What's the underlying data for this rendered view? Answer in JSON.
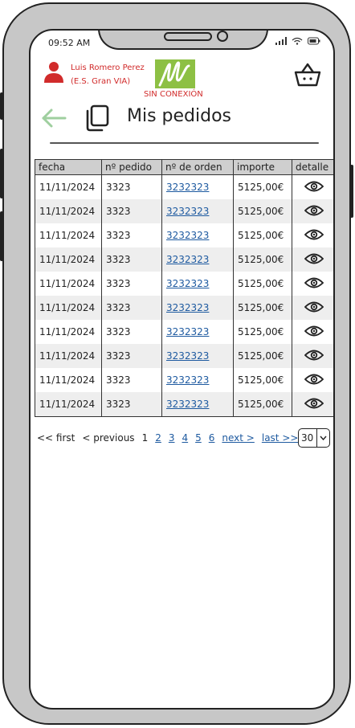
{
  "status": {
    "time": "09:52 AM"
  },
  "user": {
    "name": "Luis Romero Perez",
    "station": "(E.S. Gran VIA)"
  },
  "logo": {
    "letter": "M"
  },
  "connection": {
    "status": "SIN CONEXIÓN"
  },
  "page": {
    "title": "Mis pedidos"
  },
  "table": {
    "headers": [
      "fecha",
      "nº pedido",
      "nº de orden",
      "importe",
      "detalle"
    ],
    "rows": [
      {
        "fecha": "11/11/2024",
        "pedido": "3323",
        "orden": "3232323",
        "importe": "5125,00€"
      },
      {
        "fecha": "11/11/2024",
        "pedido": "3323",
        "orden": "3232323",
        "importe": "5125,00€"
      },
      {
        "fecha": "11/11/2024",
        "pedido": "3323",
        "orden": "3232323",
        "importe": "5125,00€"
      },
      {
        "fecha": "11/11/2024",
        "pedido": "3323",
        "orden": "3232323",
        "importe": "5125,00€"
      },
      {
        "fecha": "11/11/2024",
        "pedido": "3323",
        "orden": "3232323",
        "importe": "5125,00€"
      },
      {
        "fecha": "11/11/2024",
        "pedido": "3323",
        "orden": "3232323",
        "importe": "5125,00€"
      },
      {
        "fecha": "11/11/2024",
        "pedido": "3323",
        "orden": "3232323",
        "importe": "5125,00€"
      },
      {
        "fecha": "11/11/2024",
        "pedido": "3323",
        "orden": "3232323",
        "importe": "5125,00€"
      },
      {
        "fecha": "11/11/2024",
        "pedido": "3323",
        "orden": "3232323",
        "importe": "5125,00€"
      },
      {
        "fecha": "11/11/2024",
        "pedido": "3323",
        "orden": "3232323",
        "importe": "5125,00€"
      }
    ]
  },
  "pager": {
    "first": "<< first",
    "previous": "< previous",
    "current": "1",
    "pages": [
      "2",
      "3",
      "4",
      "5",
      "6"
    ],
    "next": "next >",
    "last": "last >>",
    "page_size": "30"
  },
  "colors": {
    "accent_red": "#d12b2b",
    "logo_green": "#8dc044",
    "link_blue": "#1e5aa0",
    "back_arrow": "#9fcf9f"
  },
  "icons": [
    "user-icon",
    "basket-icon",
    "back-arrow-icon",
    "copy-icon",
    "eye-icon",
    "chevron-down-icon",
    "signal-icon",
    "wifi-icon",
    "battery-icon"
  ]
}
